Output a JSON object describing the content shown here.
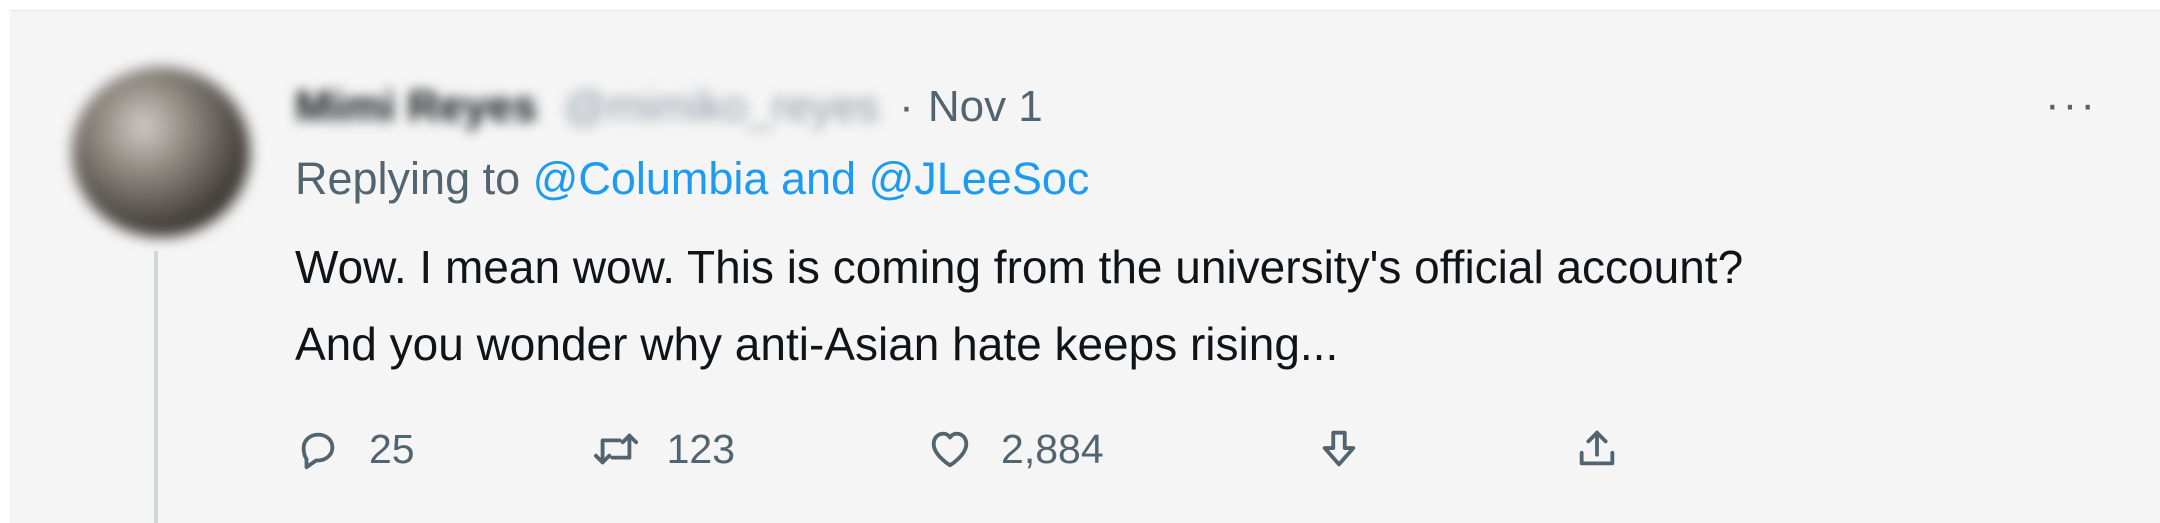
{
  "tweet": {
    "author_name": "Mimi Reyes",
    "author_handle": "@mimiko_reyes",
    "separator": "·",
    "date": "Nov 1",
    "more_label": "···",
    "replying_prefix": "Replying to",
    "mention_1": "@Columbia",
    "mention_join": "and",
    "mention_2": "@JLeeSoc",
    "text_line_1": "Wow. I mean wow. This is coming from the university's official account?",
    "text_line_2": "And you wonder why anti-Asian hate keeps rising..."
  },
  "actions": {
    "replies": "25",
    "retweets": "123",
    "likes": "2,884"
  },
  "icons": [
    "reply-icon",
    "retweet-icon",
    "like-icon",
    "downvote-icon",
    "share-icon",
    "more-icon"
  ],
  "colors": {
    "text": "#0f1419",
    "muted": "#536471",
    "link": "#1d9bf0",
    "background": "#f5f5f5"
  }
}
